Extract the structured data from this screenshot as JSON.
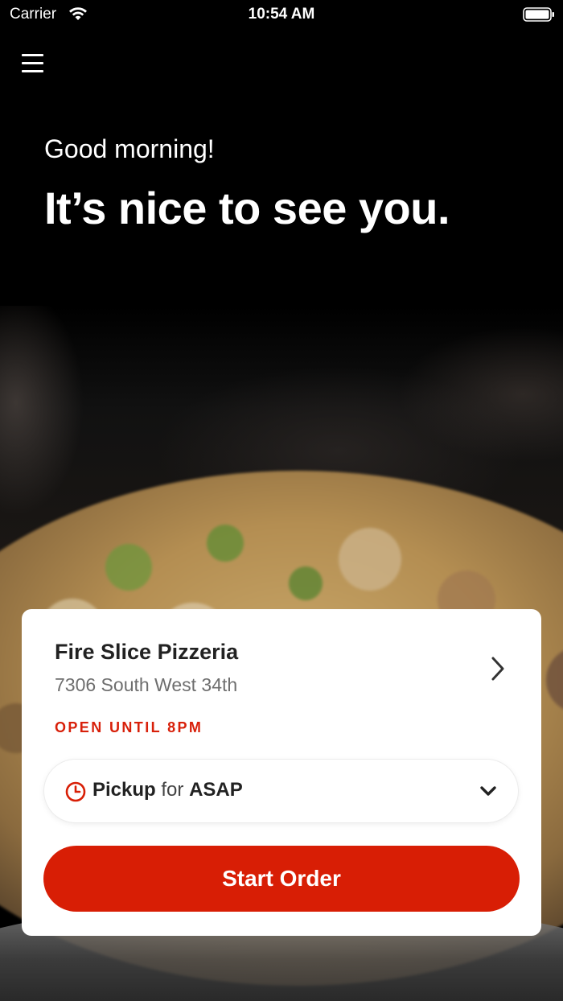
{
  "status_bar": {
    "carrier": "Carrier",
    "time": "10:54 AM",
    "icons": [
      "wifi-icon",
      "battery-icon"
    ]
  },
  "header": {
    "menu_icon": "hamburger-menu-icon",
    "greeting": "Good morning!",
    "headline": "It’s nice to see you."
  },
  "store": {
    "name": "Fire Slice Pizzeria",
    "address": "7306 South West 34th",
    "hours_status": "OPEN UNTIL 8PM"
  },
  "order_type": {
    "method": "Pickup",
    "connector": "for",
    "time": "ASAP",
    "icons": [
      "clock-icon",
      "chevron-down-icon"
    ]
  },
  "actions": {
    "start_order": "Start Order"
  },
  "colors": {
    "accent": "#d81e05",
    "background": "#000000",
    "card": "#ffffff"
  }
}
